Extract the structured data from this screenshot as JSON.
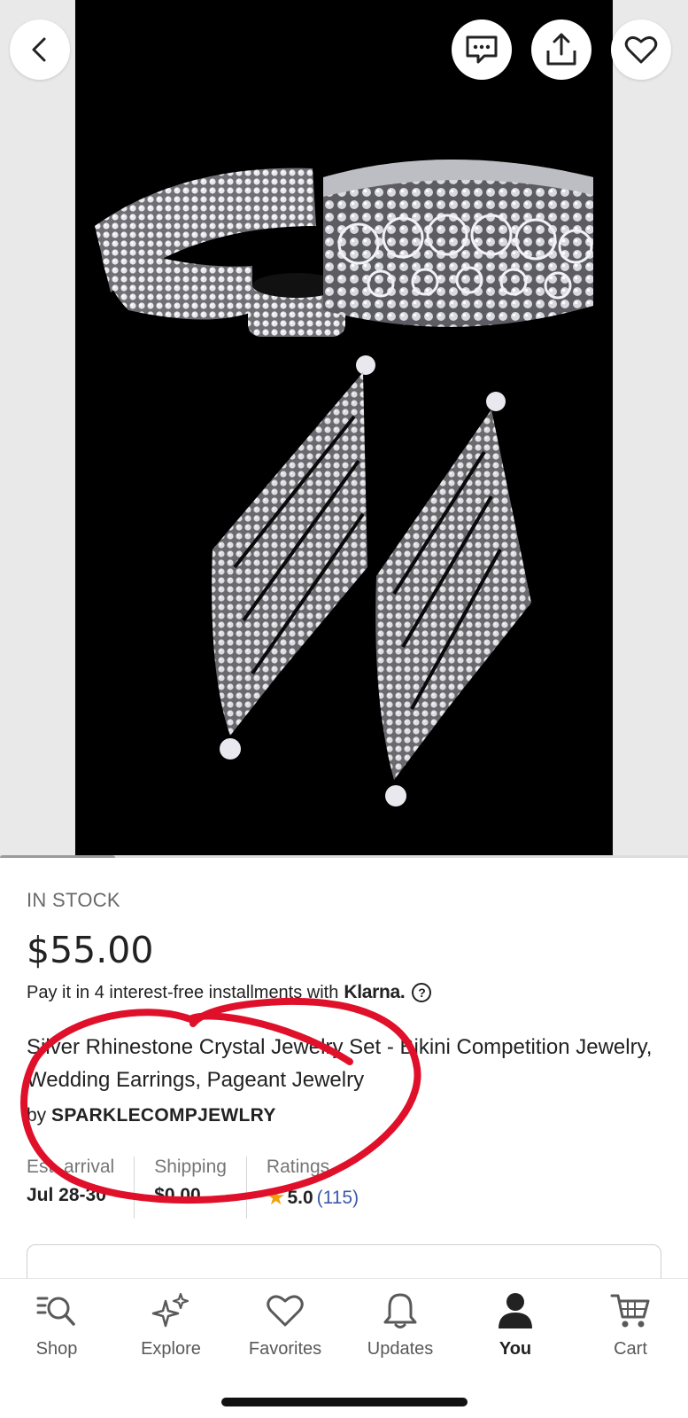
{
  "product": {
    "stock_status": "IN STOCK",
    "price": "$55.00",
    "installments_text": "Pay it in 4 interest-free installments with",
    "installments_brand": "Klarna.",
    "title": "Silver Rhinestone Crystal Jewelry Set - Bikini Competition Jewelry, Wedding Earrings, Pageant Jewelry",
    "by_prefix": "by",
    "shop_name": "SPARKLECOMPJEWLRY"
  },
  "stats": {
    "arrival_label": "Est. arrival",
    "arrival_value": "Jul 28-30",
    "shipping_label": "Shipping",
    "shipping_value": "$0.00",
    "ratings_label": "Ratings",
    "ratings_value": "5.0",
    "ratings_count": "(115)"
  },
  "image_gallery": {
    "current_index_fraction": 0.17
  },
  "header_actions": {
    "back_icon": "chevron-left-icon",
    "message_icon": "message-icon",
    "share_icon": "share-icon",
    "favorite_icon": "heart-icon"
  },
  "bottom_nav": {
    "items": [
      {
        "label": "Shop",
        "icon": "search-icon"
      },
      {
        "label": "Explore",
        "icon": "sparkle-icon"
      },
      {
        "label": "Favorites",
        "icon": "heart-icon"
      },
      {
        "label": "Updates",
        "icon": "bell-icon"
      },
      {
        "label": "You",
        "icon": "person-icon"
      },
      {
        "label": "Cart",
        "icon": "cart-icon"
      }
    ],
    "active": "You"
  },
  "colors": {
    "annotation": "#e0102a",
    "star": "#f1a10d",
    "link": "#3d5aa8"
  }
}
